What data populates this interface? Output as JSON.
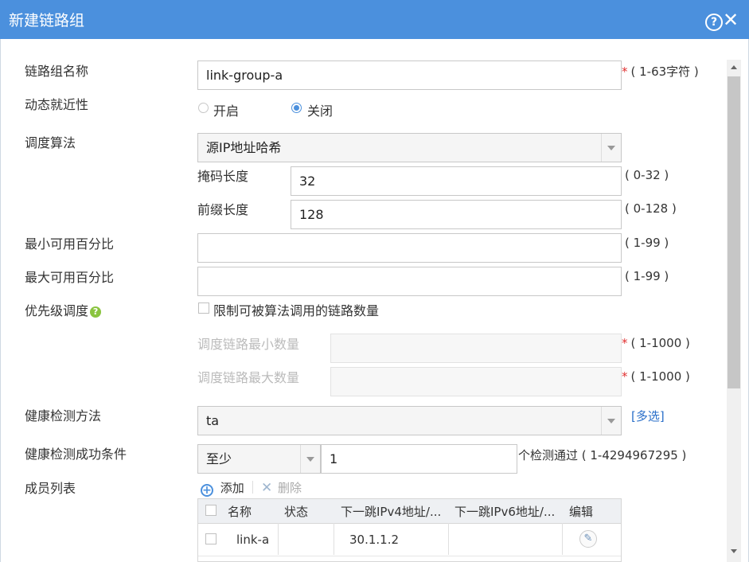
{
  "dialog": {
    "title": "新建链路组"
  },
  "fields": {
    "group_name": {
      "label": "链路组名称",
      "value": "link-group-a",
      "hint": "( 1-63字符 )"
    },
    "dynamic_proximity": {
      "label": "动态就近性",
      "option_on": "开启",
      "option_off": "关闭",
      "selected": "关闭"
    },
    "algorithm": {
      "label": "调度算法",
      "value": "源IP地址哈希"
    },
    "mask_length": {
      "label": "掩码长度",
      "value": "32",
      "hint": "( 0-32 )"
    },
    "prefix_length": {
      "label": "前缀长度",
      "value": "128",
      "hint": "( 0-128 )"
    },
    "min_percent": {
      "label": "最小可用百分比",
      "value": "",
      "hint": "( 1-99 )"
    },
    "max_percent": {
      "label": "最大可用百分比",
      "value": "",
      "hint": "( 1-99 )"
    },
    "priority": {
      "label": "优先级调度",
      "checkbox_label": "限制可被算法调用的链路数量",
      "checked": false
    },
    "min_links": {
      "label": "调度链路最小数量",
      "value": "",
      "hint": "( 1-1000 )"
    },
    "max_links": {
      "label": "调度链路最大数量",
      "value": "",
      "hint": "( 1-1000 )"
    },
    "health_method": {
      "label": "健康检测方法",
      "value": "ta",
      "multi_link": "[多选]"
    },
    "health_condition": {
      "label": "健康检测成功条件",
      "mode": "至少",
      "count": "1",
      "hint": "个检测通过 ( 1-4294967295 )"
    },
    "members": {
      "label": "成员列表",
      "add_label": "添加",
      "delete_label": "删除"
    }
  },
  "table": {
    "columns": [
      "名称",
      "状态",
      "下一跳IPv4地址/...",
      "下一跳IPv6地址/...",
      "编辑"
    ],
    "rows": [
      {
        "name": "link-a",
        "status": "",
        "ipv4": "30.1.1.2",
        "ipv6": ""
      }
    ]
  },
  "icons": [
    "help-icon",
    "close-icon",
    "question-icon",
    "add-icon",
    "delete-icon",
    "edit-icon"
  ],
  "colors": {
    "titlebar": "#4b90dd",
    "required": "#e03030",
    "link": "#2a6fc9",
    "help_green": "#8ac43f"
  }
}
